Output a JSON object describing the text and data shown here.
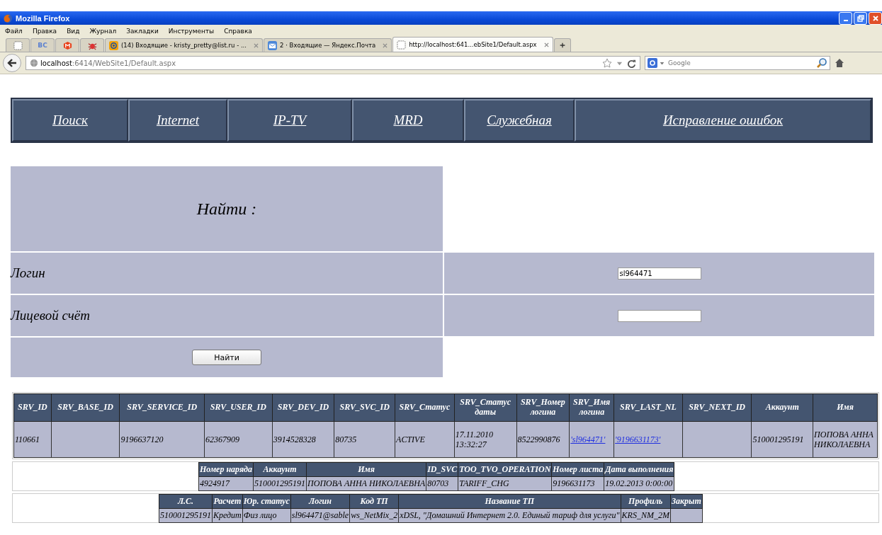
{
  "window": {
    "title": "Mozilla Firefox"
  },
  "menu": [
    "Файл",
    "Правка",
    "Вид",
    "Журнал",
    "Закладки",
    "Инструменты",
    "Справка"
  ],
  "tabs": [
    {
      "kind": "pinned",
      "selected": false
    },
    {
      "kind": "pinned",
      "label": "ВС",
      "selected": false
    },
    {
      "kind": "pinned",
      "selected": false
    },
    {
      "kind": "pinned",
      "selected": false
    },
    {
      "kind": "tab",
      "label": "(14) Входящие - kristy_pretty@list.ru - ...",
      "selected": false
    },
    {
      "kind": "tab",
      "label": "2 · Входящие — Яндекс.Почта",
      "selected": false
    },
    {
      "kind": "tab",
      "label": "http://localhost:641...ebSite1/Default.aspx",
      "selected": true
    }
  ],
  "address": {
    "host": "localhost",
    "path": ":6414/WebSite1/Default.aspx"
  },
  "search": {
    "placeholder": "Google"
  },
  "nav": [
    "Поиск",
    "Internet",
    "IP-TV",
    "MRD",
    "Служебная",
    "Исправление ошибок"
  ],
  "form": {
    "title": "Найти :",
    "fields": [
      {
        "label": "Логин",
        "value": "sl964471"
      },
      {
        "label": "Лицевой счёт"
      }
    ],
    "button": "Найти"
  },
  "main_table": {
    "columns": [
      "SRV_ID",
      "SRV_BASE_ID",
      "SRV_SERVICE_ID",
      "SRV_USER_ID",
      "SRV_DEV_ID",
      "SRV_SVC_ID",
      "SRV_Статус",
      "SRV_Статус даты",
      "SRV_Номер логина",
      "SRV_Имя логина",
      "SRV_LAST_NL",
      "SRV_NEXT_ID",
      "Аккаунт",
      "Имя"
    ],
    "rows": [
      [
        {
          "text": "110661"
        },
        {
          "text": ""
        },
        {
          "text": "9196637120"
        },
        {
          "text": "62367909"
        },
        {
          "text": "3914528328"
        },
        {
          "text": "80735"
        },
        {
          "text": "ACTIVE"
        },
        {
          "text": "17.11.2010 13:32:27"
        },
        {
          "text": "8522990876"
        },
        {
          "text": "'sl964471'",
          "kind": "link"
        },
        {
          "text": "'9196631173'",
          "kind": "link"
        },
        {
          "text": ""
        },
        {
          "text": "510001295191"
        },
        {
          "text": "ПОПОВА АННА НИКОЛАЕВНА"
        }
      ]
    ]
  },
  "order_table": {
    "columns": [
      "Номер наряда",
      "Аккаунт",
      "Имя",
      "ID_SVC",
      "TOO_TVO_OPERATION",
      "Номер листа",
      "Дата выполнения"
    ],
    "rows": [
      [
        "4924917",
        "510001295191",
        "ПОПОВА АННА НИКОЛАЕВНА",
        "80703",
        "TARIFF_CHG",
        "9196631173",
        "19.02.2013 0:00:00"
      ]
    ]
  },
  "account_table": {
    "columns": [
      "Л.С.",
      "Расчет",
      "Юр. статус",
      "Логин",
      "Код ТП",
      "Название ТП",
      "Профиль",
      "Закрыт"
    ],
    "rows": [
      [
        "510001295191",
        "Кредит",
        "Физ лицо",
        "sl964471@sable",
        "ws_NetMix_2",
        "xDSL, \"Домашний Интернет 2.0. Единый тариф для услуги\"",
        "KRS_NM_2M",
        ""
      ]
    ]
  }
}
